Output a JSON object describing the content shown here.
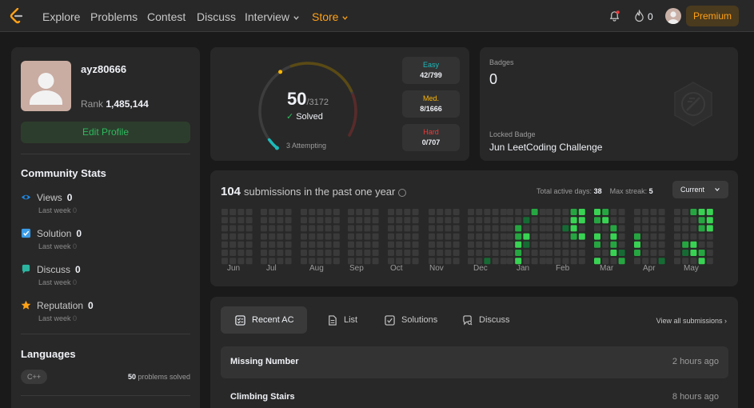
{
  "nav": {
    "items": [
      "Explore",
      "Problems",
      "Contest",
      "Discuss",
      "Interview",
      "Store"
    ],
    "fire_count": "0",
    "premium_label": "Premium"
  },
  "profile": {
    "username": "ayz80666",
    "rank_label": "Rank",
    "rank_value": "1,485,144",
    "edit_label": "Edit Profile"
  },
  "community": {
    "title": "Community Stats",
    "stats": [
      {
        "label": "Views",
        "value": "0",
        "sub_label": "Last week",
        "sub_value": "0",
        "icon": "eye-icon",
        "color": "#1e88e5"
      },
      {
        "label": "Solution",
        "value": "0",
        "sub_label": "Last week",
        "sub_value": "0",
        "icon": "check-square-icon",
        "color": "#3b9ce8"
      },
      {
        "label": "Discuss",
        "value": "0",
        "sub_label": "Last week",
        "sub_value": "0",
        "icon": "chat-bubble-icon",
        "color": "#2bb5a0"
      },
      {
        "label": "Reputation",
        "value": "0",
        "sub_label": "Last week",
        "sub_value": "0",
        "icon": "star-icon",
        "color": "#ffa116"
      }
    ]
  },
  "languages": {
    "title": "Languages",
    "items": [
      {
        "name": "C++",
        "count": "50",
        "suffix": "problems solved"
      }
    ]
  },
  "solved": {
    "count": "50",
    "total": "/3172",
    "label": "Solved",
    "attempting": "3 Attempting",
    "easy_fraction": 0.0526,
    "difficulties": [
      {
        "label": "Easy",
        "value": "42/799"
      },
      {
        "label": "Med.",
        "value": "8/1666"
      },
      {
        "label": "Hard",
        "value": "0/707"
      }
    ]
  },
  "badges": {
    "title": "Badges",
    "count": "0",
    "locked_label": "Locked Badge",
    "locked_name": "Jun LeetCoding Challenge"
  },
  "submissions": {
    "count": "104",
    "label": "submissions in the past one year",
    "active_days_label": "Total active days:",
    "active_days": "38",
    "max_streak_label": "Max streak:",
    "max_streak": "5",
    "dropdown": "Current",
    "months": [
      "Jun",
      "Jul",
      "Aug",
      "Sep",
      "Oct",
      "Nov",
      "Dec",
      "Jan",
      "Feb",
      "Mar",
      "Apr",
      "May"
    ],
    "colors": {
      "empty": "#3a3a3a",
      "low": "#166b34",
      "mid": "#26a641",
      "high": "#39d353"
    }
  },
  "recent": {
    "tabs": [
      "Recent AC",
      "List",
      "Solutions",
      "Discuss"
    ],
    "view_all": "View all submissions",
    "rows": [
      {
        "title": "Missing Number",
        "time": "2 hours ago"
      },
      {
        "title": "Climbing Stairs",
        "time": "8 hours ago"
      }
    ]
  }
}
